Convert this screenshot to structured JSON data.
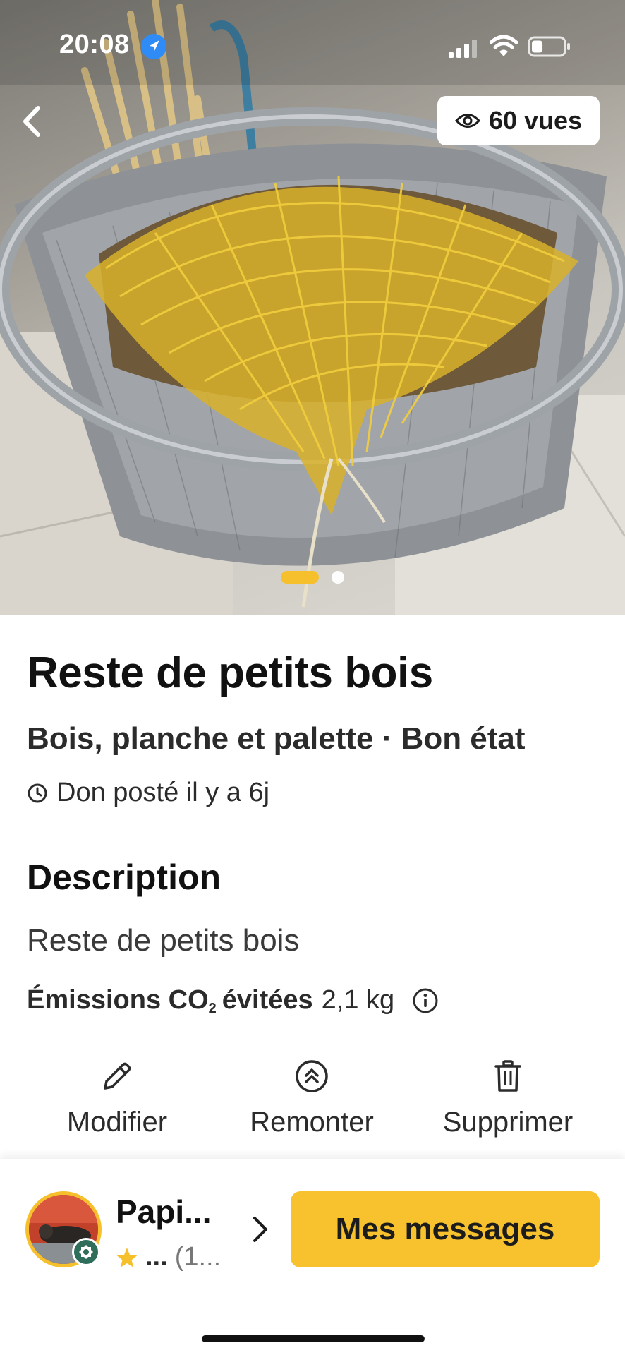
{
  "status_bar": {
    "time": "20:08",
    "location_icon": "location-arrow-icon",
    "signal_icon": "cellular-signal-icon",
    "wifi_icon": "wifi-icon",
    "battery_icon": "battery-icon",
    "battery_level": 0.35
  },
  "hero": {
    "back_icon": "chevron-left-icon",
    "views_icon": "eye-icon",
    "views_label": "60 vues",
    "image_count": 2,
    "active_image_index": 1,
    "photo_subject": "yellow mesh bag of wood pieces in a metal mesh bin"
  },
  "item": {
    "title": "Reste de petits bois",
    "subtitle": "Bois, planche et palette · Bon état",
    "posted_icon": "clock-icon",
    "posted": "Don posté il y a 6j"
  },
  "description": {
    "heading": "Description",
    "text": "Reste de petits bois",
    "co2_label_main": "Émissions CO",
    "co2_label_sub": "2",
    "co2_label_end": "évitées",
    "co2_value": "2,1 kg",
    "co2_info_icon": "info-circle-icon"
  },
  "actions": [
    {
      "label": "Modifier",
      "icon": "pencil-icon"
    },
    {
      "label": "Remonter",
      "icon": "double-chevron-up-circle-icon"
    },
    {
      "label": "Supprimer",
      "icon": "trash-icon"
    }
  ],
  "bottom": {
    "user_name": "Papi...",
    "rating_text": "...",
    "rating_count": "(1...",
    "star_icon": "star-icon",
    "chevron_icon": "chevron-right-icon",
    "messages_label": "Mes messages"
  },
  "colors": {
    "accent": "#f7c22e",
    "text": "#1a1a1a",
    "location_blue": "#2f8cf7"
  }
}
